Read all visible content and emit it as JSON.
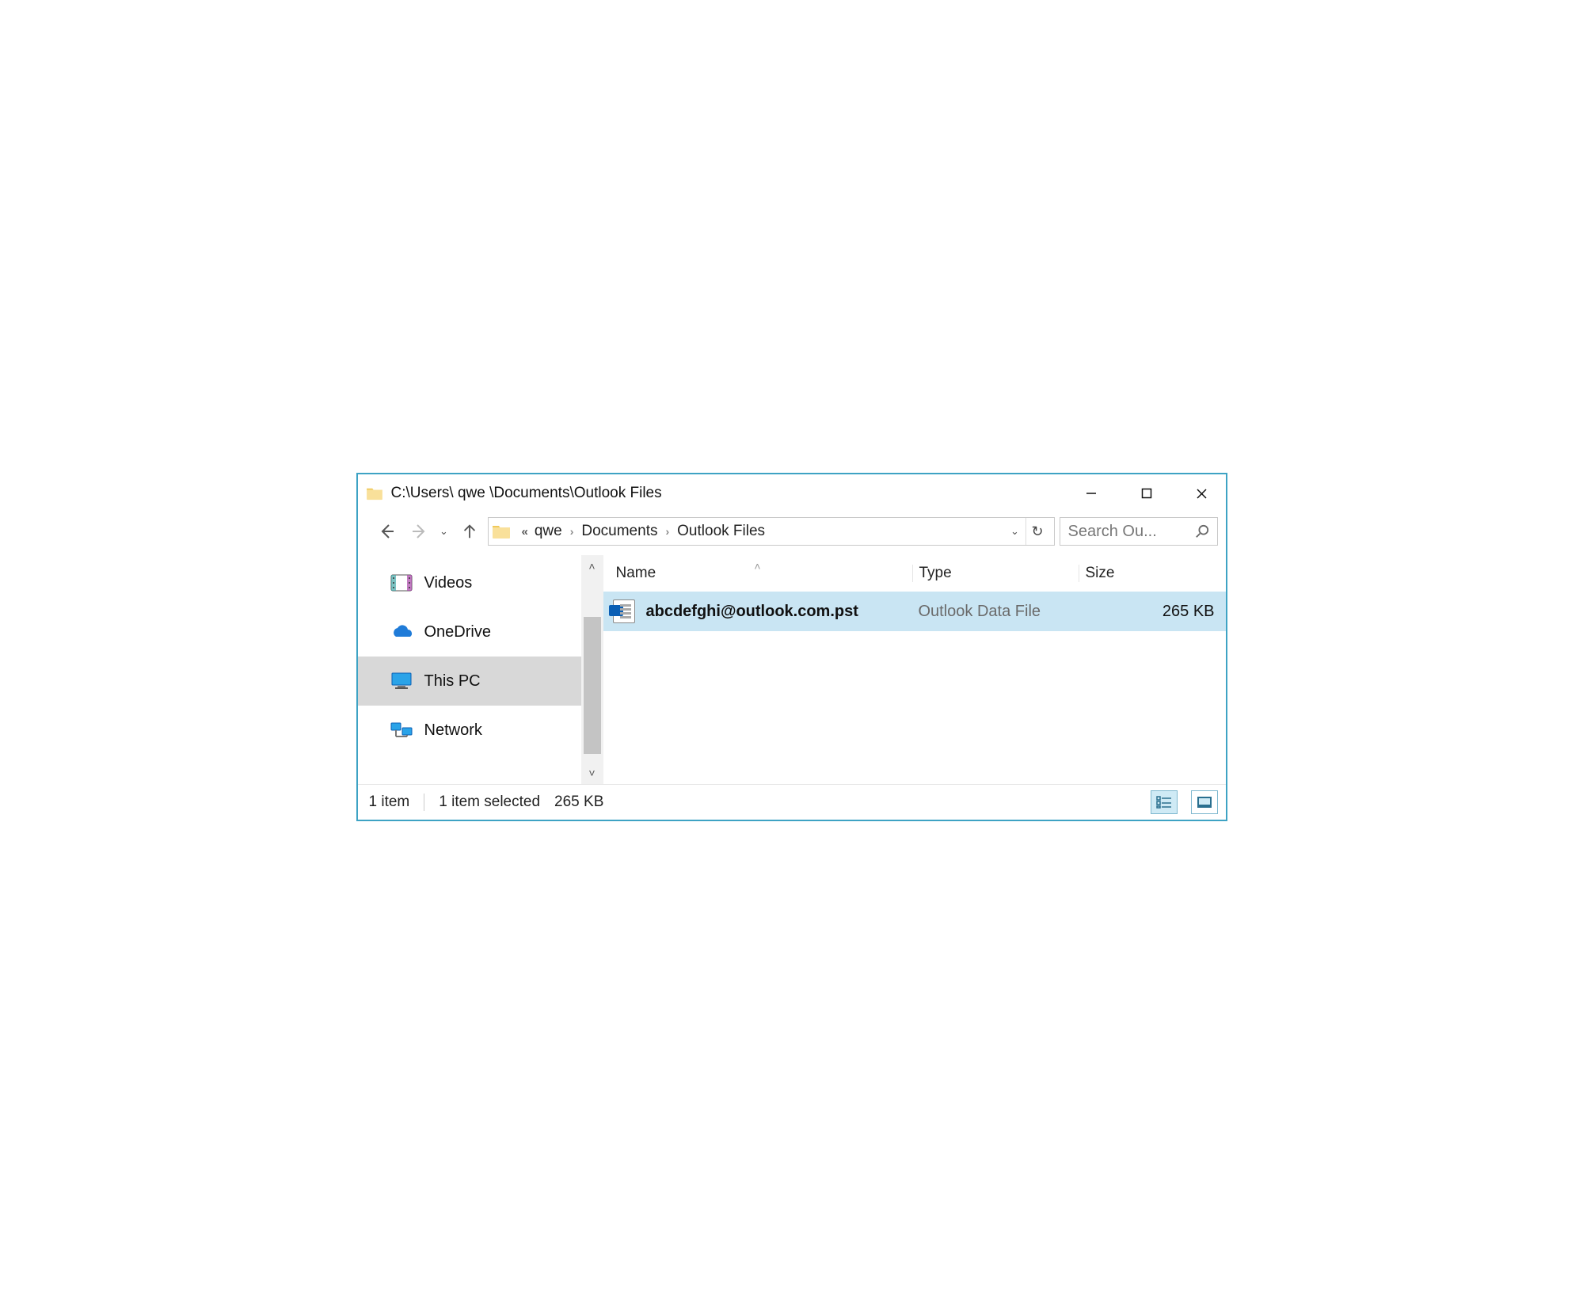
{
  "window": {
    "title": "C:\\Users\\ qwe \\Documents\\Outlook Files"
  },
  "breadcrumb": {
    "segments": [
      "qwe",
      "Documents",
      "Outlook Files"
    ]
  },
  "search": {
    "placeholder": "Search Ou..."
  },
  "sidebar": {
    "items": [
      {
        "label": "Videos",
        "icon": "videos-icon",
        "selected": false
      },
      {
        "label": "OneDrive",
        "icon": "onedrive-icon",
        "selected": false
      },
      {
        "label": "This PC",
        "icon": "thispc-icon",
        "selected": true
      },
      {
        "label": "Network",
        "icon": "network-icon",
        "selected": false
      }
    ]
  },
  "columns": {
    "name": "Name",
    "type": "Type",
    "size": "Size",
    "sorted_by": "name",
    "sort_dir": "asc"
  },
  "files": [
    {
      "name": "abcdefghi@outlook.com.pst",
      "type": "Outlook Data File",
      "size": "265 KB",
      "selected": true
    }
  ],
  "status": {
    "count": "1 item",
    "selection": "1 item selected",
    "size": "265 KB"
  }
}
